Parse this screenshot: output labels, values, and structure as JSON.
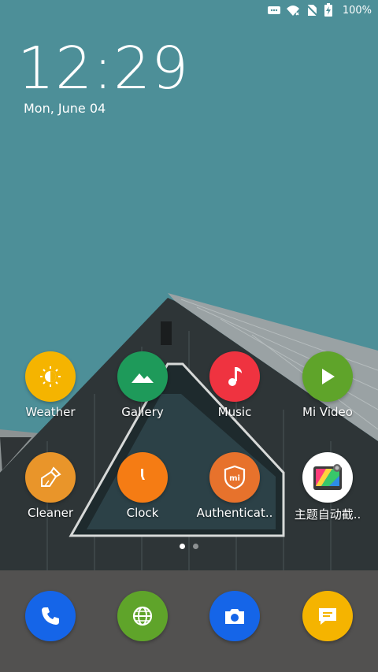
{
  "status_bar": {
    "battery_percent": "100%",
    "icons": [
      "notification-icon",
      "wifi-icon",
      "no-sim-icon",
      "battery-charging-icon"
    ]
  },
  "clock": {
    "time": "12:29",
    "date": "Mon, June 04"
  },
  "apps": [
    {
      "label": "Weather",
      "icon": "weather-icon",
      "color": "#f5b400"
    },
    {
      "label": "Gallery",
      "icon": "gallery-icon",
      "color": "#1e9a5a"
    },
    {
      "label": "Music",
      "icon": "music-icon",
      "color": "#ef3340"
    },
    {
      "label": "Mi Video",
      "icon": "play-icon",
      "color": "#5fa42a"
    },
    {
      "label": "Cleaner",
      "icon": "broom-icon",
      "color": "#e9952a"
    },
    {
      "label": "Clock",
      "icon": "clock-icon",
      "color": "#f57c14"
    },
    {
      "label": "Authenticat..",
      "icon": "mi-shield-icon",
      "color": "#e7722c"
    },
    {
      "label": "主题自动截..",
      "icon": "theme-screenshot-icon",
      "color": "#ffffff"
    }
  ],
  "page_indicator": {
    "pages": 2,
    "active": 1
  },
  "dock": [
    {
      "icon": "phone-icon",
      "color": "#1565e8"
    },
    {
      "icon": "browser-icon",
      "color": "#5fa42a"
    },
    {
      "icon": "camera-icon",
      "color": "#1565e8"
    },
    {
      "icon": "messages-icon",
      "color": "#f5b400"
    }
  ]
}
